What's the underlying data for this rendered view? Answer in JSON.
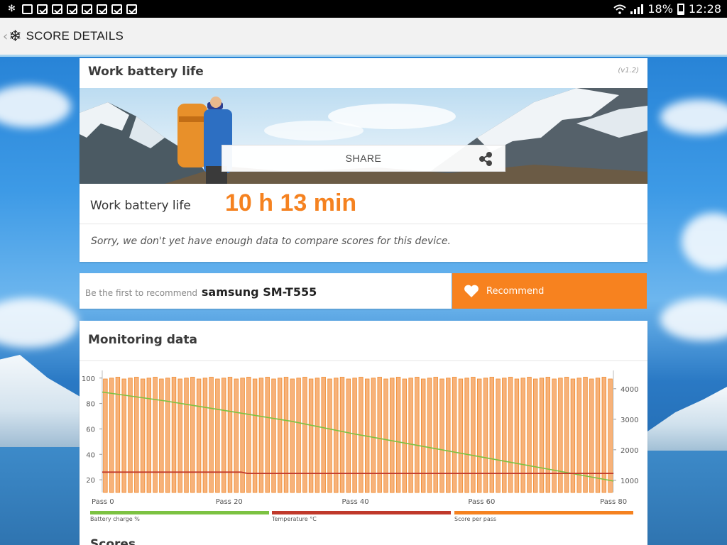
{
  "statusbar": {
    "battery_percent": "18%",
    "time": "12:28"
  },
  "actionbar": {
    "title": "SCORE DETAILS",
    "back_icon": "chevron-left-icon",
    "app_icon": "snowflake-icon"
  },
  "result_card": {
    "title": "Work battery life",
    "version": "(v1.2)",
    "share_label": "SHARE",
    "result_label": "Work battery life",
    "result_value": "10 h 13 min",
    "notice": "Sorry, we don't yet have enough data to compare scores for this device."
  },
  "recommend": {
    "prefix": "Be the first to recommend",
    "device": "samsung SM-T555",
    "button_label": "Recommend"
  },
  "monitoring": {
    "title": "Monitoring data",
    "next_section_title": "Scores"
  },
  "colors": {
    "accent_orange": "#f7821f",
    "battery_green": "#7cc242",
    "temperature_red": "#c0392b",
    "score_orange": "#f58220"
  },
  "chart_data": {
    "type": "bar",
    "title": "",
    "x_ticks": [
      {
        "value": 0,
        "label": "Pass 0"
      },
      {
        "value": 20,
        "label": "Pass 20"
      },
      {
        "value": 40,
        "label": "Pass 40"
      },
      {
        "value": 60,
        "label": "Pass 60"
      },
      {
        "value": 80,
        "label": "Pass 80"
      }
    ],
    "xlim": [
      0,
      81
    ],
    "left_axis": {
      "ticks": [
        20,
        40,
        60,
        80,
        100
      ],
      "range": [
        10,
        106
      ]
    },
    "right_axis": {
      "ticks": [
        1000,
        2000,
        3000,
        4000
      ],
      "range": [
        600,
        4600
      ]
    },
    "legend_placement": "bottom",
    "series": [
      {
        "name": "Battery charge %",
        "axis": "left",
        "kind": "line",
        "points": [
          [
            0,
            89
          ],
          [
            10,
            82
          ],
          [
            20,
            74
          ],
          [
            30,
            66
          ],
          [
            40,
            56
          ],
          [
            50,
            47
          ],
          [
            60,
            38
          ],
          [
            70,
            29
          ],
          [
            81,
            19
          ]
        ]
      },
      {
        "name": "Temperature °C",
        "axis": "left",
        "kind": "line",
        "points": [
          [
            0,
            26
          ],
          [
            22,
            26
          ],
          [
            23,
            25
          ],
          [
            81,
            25
          ]
        ]
      },
      {
        "name": "Score per pass",
        "axis": "right",
        "kind": "bar",
        "typical_value": 4350,
        "count": 82
      }
    ]
  }
}
